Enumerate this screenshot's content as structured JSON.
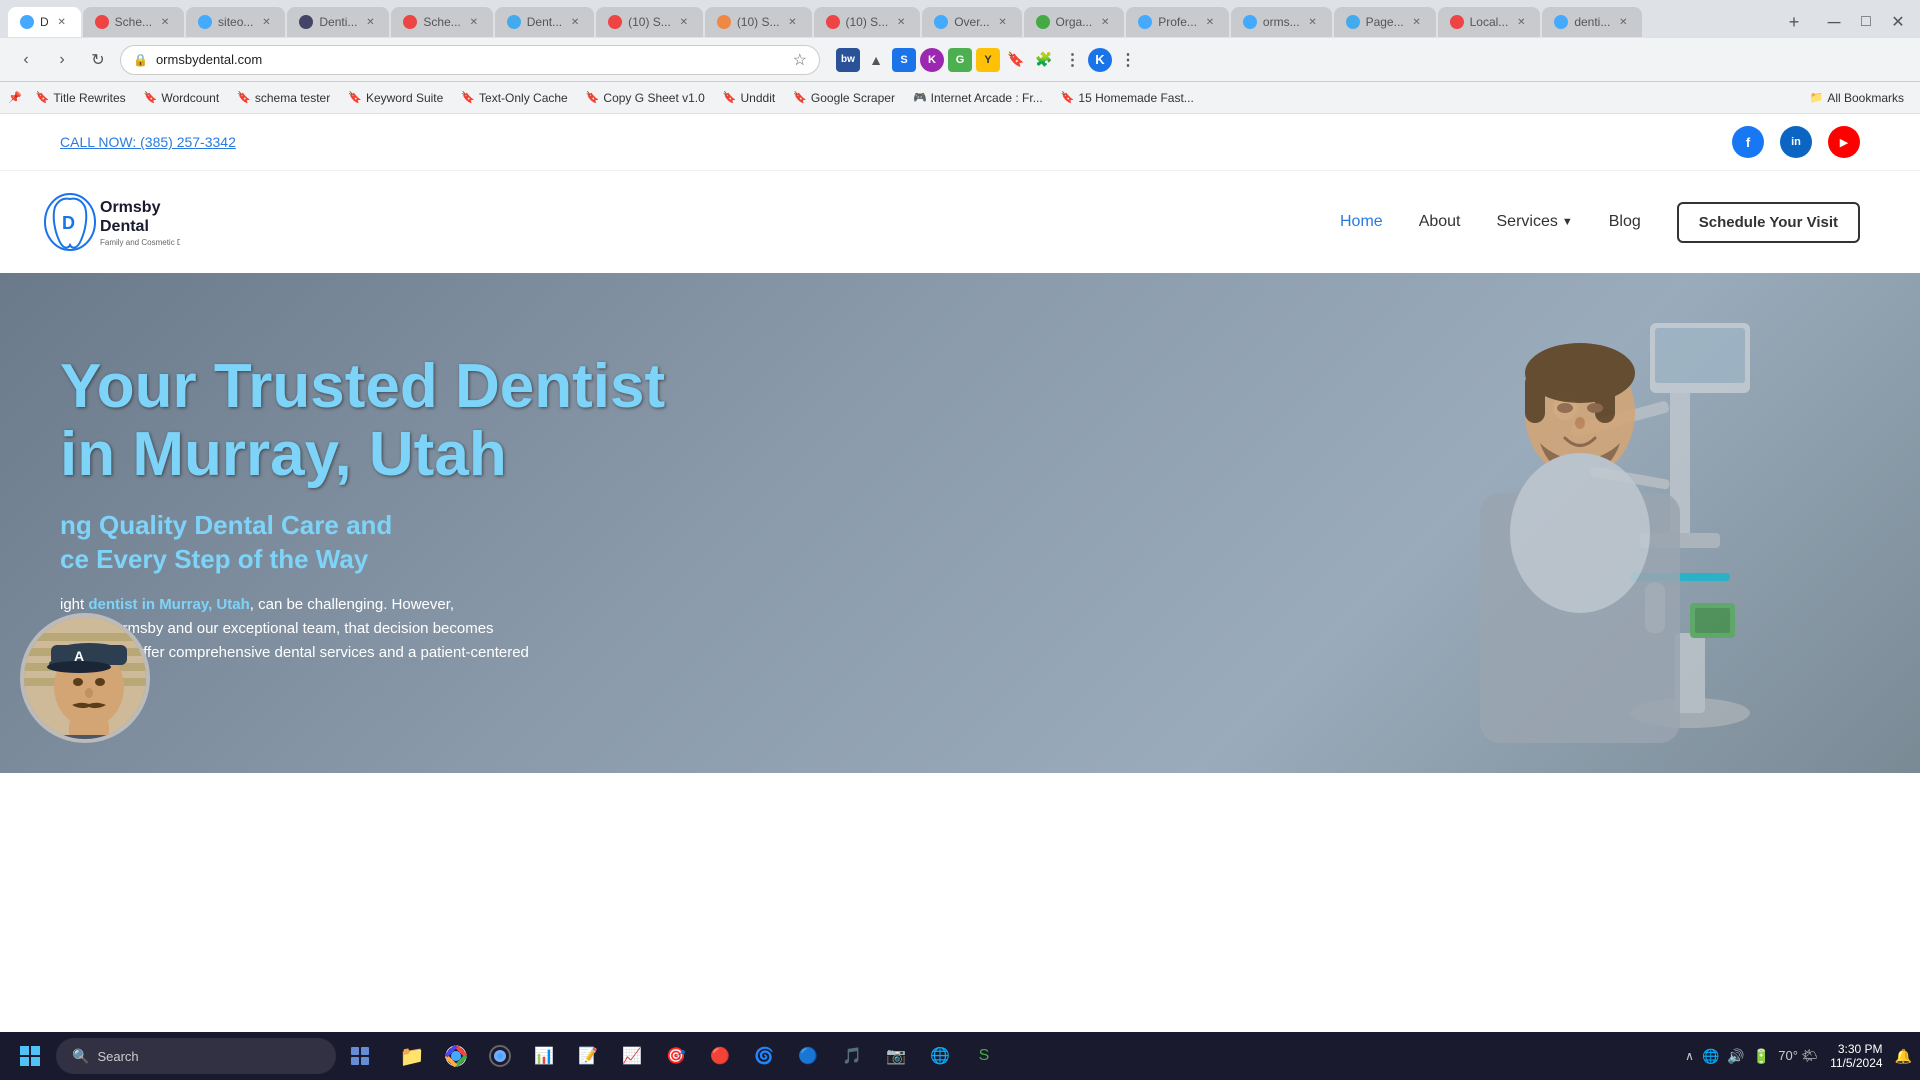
{
  "browser": {
    "tabs": [
      {
        "label": "D",
        "url": "",
        "active": true,
        "favicon_color": "#4af"
      },
      {
        "label": "Sche...",
        "url": "",
        "active": false,
        "favicon_color": "#e44"
      },
      {
        "label": "siteo...",
        "url": "",
        "active": false,
        "favicon_color": "#4af"
      },
      {
        "label": "Denti...",
        "url": "",
        "active": false,
        "favicon_color": "#446"
      },
      {
        "label": "Sche...",
        "url": "",
        "active": false,
        "favicon_color": "#e44"
      },
      {
        "label": "Dent...",
        "url": "",
        "active": false,
        "favicon_color": "#4ae"
      },
      {
        "label": "(10) S...",
        "url": "",
        "active": false,
        "favicon_color": "#e44"
      },
      {
        "label": "(10) S...",
        "url": "",
        "active": false,
        "favicon_color": "#e84"
      },
      {
        "label": "(10) S...",
        "url": "",
        "active": false,
        "favicon_color": "#e44"
      },
      {
        "label": "Over...",
        "url": "",
        "active": false,
        "favicon_color": "#4af"
      },
      {
        "label": "Orga...",
        "url": "",
        "active": false,
        "favicon_color": "#4a4"
      },
      {
        "label": "Profe...",
        "url": "",
        "active": false,
        "favicon_color": "#4af"
      },
      {
        "label": "orms...",
        "url": "",
        "active": false,
        "favicon_color": "#4af"
      },
      {
        "label": "Page...",
        "url": "",
        "active": false,
        "favicon_color": "#4ae"
      },
      {
        "label": "Local...",
        "url": "",
        "active": false,
        "favicon_color": "#e44"
      },
      {
        "label": "denti...",
        "url": "",
        "active": false,
        "favicon_color": "#4af"
      }
    ],
    "address": "ormsbydental.com",
    "new_tab_label": "+"
  },
  "bookmarks": [
    {
      "label": "Title Rewrites",
      "icon": "🔖"
    },
    {
      "label": "Wordcount",
      "icon": "🔖"
    },
    {
      "label": "schema tester",
      "icon": "🔖"
    },
    {
      "label": "Keyword Suite",
      "icon": "🔖"
    },
    {
      "label": "Text-Only Cache",
      "icon": "🔖"
    },
    {
      "label": "Copy G Sheet v1.0",
      "icon": "🔖"
    },
    {
      "label": "Unddit",
      "icon": "🔖"
    },
    {
      "label": "Google Scraper",
      "icon": "🔖"
    },
    {
      "label": "Internet Arcade : Fr...",
      "icon": "🎮"
    },
    {
      "label": "15 Homemade Fast...",
      "icon": "🔖"
    },
    {
      "label": "All Bookmarks",
      "icon": "📁"
    }
  ],
  "site": {
    "phone": "CALL NOW: (385) 257-3342",
    "social": {
      "facebook": "f",
      "linkedin": "in",
      "youtube": "▶"
    },
    "nav": {
      "home": "Home",
      "about": "About",
      "services": "Services",
      "blog": "Blog",
      "schedule": "Schedule Your Visit"
    },
    "logo_text_line1": "Ormsby",
    "logo_text_line2": "Dental",
    "logo_text_line3": "Family and Cosmetic Dentistry",
    "hero": {
      "title_line1": "Your Trusted Dentist",
      "title_line2": "in Murray, Utah",
      "subtitle_line1": "ng Quality Dental Care and",
      "subtitle_line2": "ce Every Step of the Way",
      "body": "ight dentist in Murray, Utah, can be challenging. However,\n Daniel Ormsby and our exceptional team, that decision becomes\neasier. We offer comprehensive dental services and a patient-centered"
    }
  },
  "taskbar": {
    "search_placeholder": "Search",
    "time": "3:30 PM",
    "date": "11/5/2024",
    "temperature": "70°",
    "apps": [
      "🪟",
      "📁",
      "🌐",
      "🎵",
      "📊",
      "📝",
      "📈",
      "🎯",
      "🔴",
      "🌀",
      "🔵",
      "🟡"
    ]
  }
}
